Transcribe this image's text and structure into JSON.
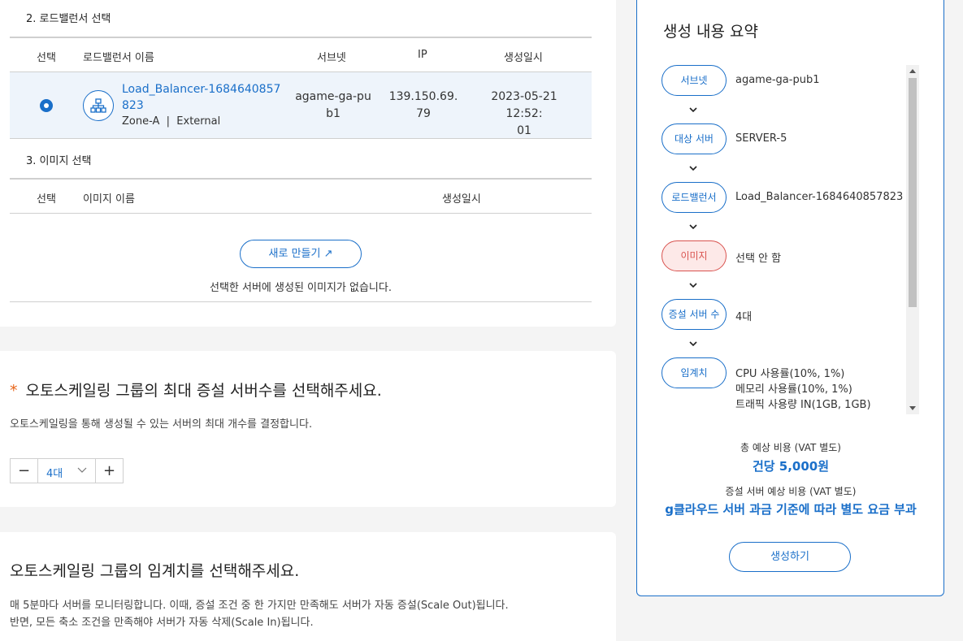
{
  "section2": {
    "title": "2. 로드밸런서 선택",
    "headers": [
      "선택",
      "로드밸런서 이름",
      "서브넷",
      "IP",
      "생성일시"
    ],
    "row": {
      "name_line1": "Load_Balancer-1684640857",
      "name_line2": "823",
      "meta": "Zone-A  |  External",
      "subnet_line1": "agame-ga-pu",
      "subnet_line2": "b1",
      "ip_line1": "139.150.69.",
      "ip_line2": "79",
      "date_line1": "2023-05-21 12:52:",
      "date_line2": "01"
    }
  },
  "section3": {
    "title": "3. 이미지 선택",
    "headers": [
      "선택",
      "이미지 이름",
      "생성일시"
    ],
    "new_button": "새로 만들기 ↗",
    "empty_message": "선택한 서버에 생성된 이미지가 없습니다."
  },
  "max_servers": {
    "required_mark": "*",
    "title": "오토스케일링 그룹의 최대 증설 서버수를 선택해주세요.",
    "description": "오토스케일링을 통해 생성될 수 있는 서버의 최대 개수를 결정합니다.",
    "stepper_minus": "−",
    "stepper_value": "4대",
    "stepper_plus": "+"
  },
  "threshold": {
    "title": "오토스케일링 그룹의 임계치를 선택해주세요.",
    "desc_line1": "매 5분마다 서버를 모니터링합니다. 이때, 증설 조건 중 한 가지만 만족해도 서버가 자동 증설(Scale Out)됩니다.",
    "desc_line2": "반면, 모든 축소 조건을 만족해야 서버가 자동 삭제(Scale In)됩니다."
  },
  "summary": {
    "title": "생성 내용 요약",
    "items": [
      {
        "label": "서브넷",
        "value": "agame-ga-pub1"
      },
      {
        "label": "대상 서버",
        "value": "SERVER-5"
      },
      {
        "label": "로드밸런서",
        "value": "Load_Balancer-1684640857823"
      },
      {
        "label": "이미지",
        "value": "선택 안 함"
      },
      {
        "label": "증설 서버 수",
        "value": "4대"
      },
      {
        "label": "임계치",
        "lines": [
          "CPU 사용률(10%, 1%)",
          "메모리 사용률(10%, 1%)",
          "트래픽 사용량 IN(1GB, 1GB)"
        ]
      }
    ],
    "total_cost_label": "총 예상 비용 (VAT 별도)",
    "total_cost_value": "건당 5,000원",
    "extra_cost_label": "증설 서버 예상 비용 (VAT 별도)",
    "extra_cost_value": "g클라우드 서버 과금 기준에 따라 별도 요금 부과",
    "create_button": "생성하기"
  },
  "colors": {
    "accent": "#1a6fc9",
    "warning": "#d9534f",
    "required": "#e8651a"
  }
}
